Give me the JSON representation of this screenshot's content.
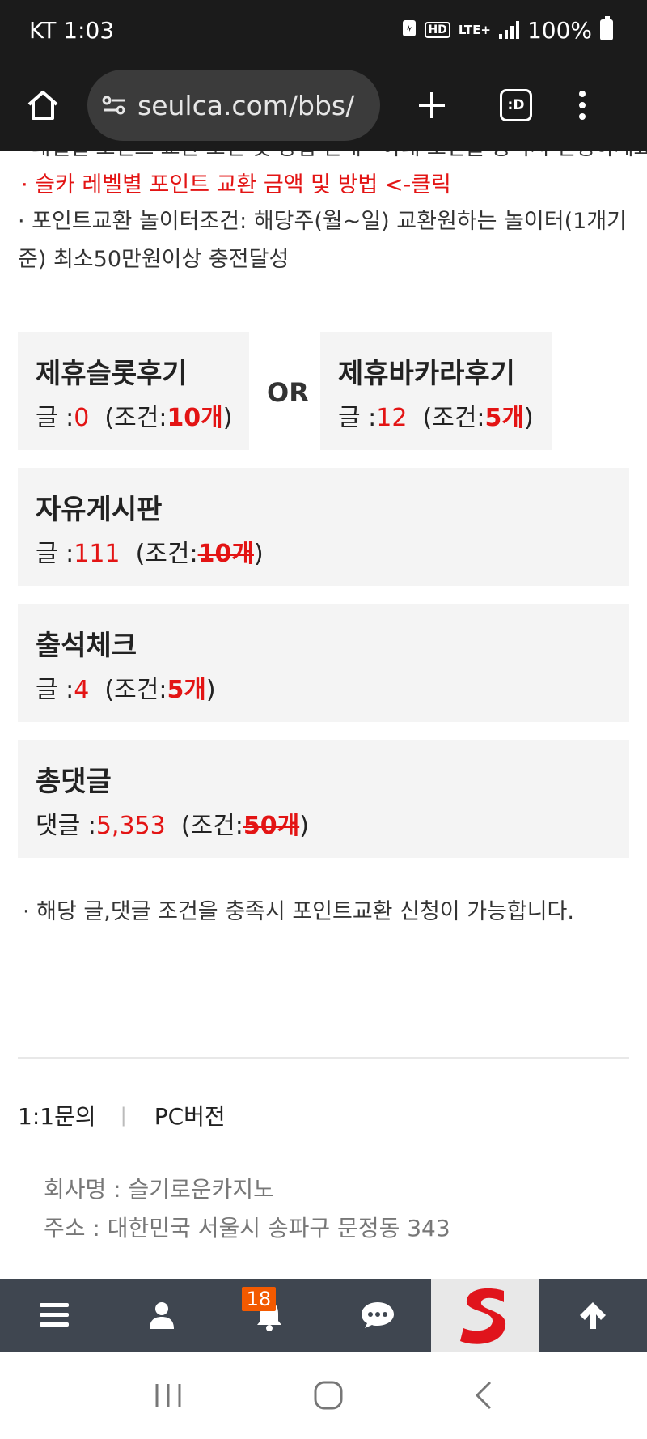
{
  "status_bar": {
    "carrier_time": "KT 1:03",
    "hd_label": "HD",
    "network_label": "LTE+",
    "battery_label": "100%",
    "icons": [
      "data-saver-icon",
      "hd-icon",
      "lte-icon",
      "signal-icon",
      "battery-icon"
    ]
  },
  "browser": {
    "url": "seulca.com/bbs/",
    "tabs_label": ":D",
    "icons": [
      "home-icon",
      "tune-icon",
      "plus-icon",
      "tabs-icon",
      "more-vert-icon"
    ]
  },
  "notices": {
    "cut_line": "· 레벨별 포인트 교환 조건 및 방법 안내 · 아래 조건을 충족시 신청하세요",
    "red_link": "· 슬카 레벨별 포인트 교환 금액 및 방법 <-클릭",
    "condition": "· 포인트교환 놀이터조건: 해당주(월~일) 교환원하는 놀이터(1개기준) 최소50만원이상 충전달성"
  },
  "cards": {
    "or_label": "OR",
    "slot_review": {
      "title": "제휴슬롯후기",
      "label": "글 :",
      "count": "0",
      "cond_open": "(조건:",
      "cond_value": "10개",
      "cond_close": ")"
    },
    "baccarat_review": {
      "title": "제휴바카라후기",
      "label": "글 :",
      "count": "12",
      "cond_open": "(조건:",
      "cond_value": "5개",
      "cond_close": ")"
    },
    "free_board": {
      "title": "자유게시판",
      "label": "글 :",
      "count": "111",
      "cond_open": "(조건:",
      "cond_value": "10개",
      "cond_close": ")"
    },
    "attendance": {
      "title": "출석체크",
      "label": "글 :",
      "count": "4",
      "cond_open": "(조건:",
      "cond_value": "5개",
      "cond_close": ")"
    },
    "total_comments": {
      "title": "총댓글",
      "label": "댓글 :",
      "count": "5,353",
      "cond_open": "(조건:",
      "cond_value": "50개",
      "cond_close": ")"
    }
  },
  "footer": {
    "note": "· 해당 글,댓글 조건을 충족시 포인트교환 신청이 가능합니다.",
    "links": [
      "1:1문의",
      "PC버전"
    ],
    "separator": "|",
    "company_name": "회사명 : 슬기로운카지노",
    "address": "주소 : 대한민국 서울시 송파구 문정동 343"
  },
  "bottom_nav": {
    "notification_count": "18",
    "icons": [
      "menu-icon",
      "user-icon",
      "bell-icon",
      "chat-icon",
      "site-logo-icon",
      "arrow-up-icon"
    ],
    "accent_color": "#f35a00"
  },
  "system_nav": {
    "icons": [
      "recent-apps-icon",
      "home-circle-icon",
      "back-icon"
    ]
  }
}
